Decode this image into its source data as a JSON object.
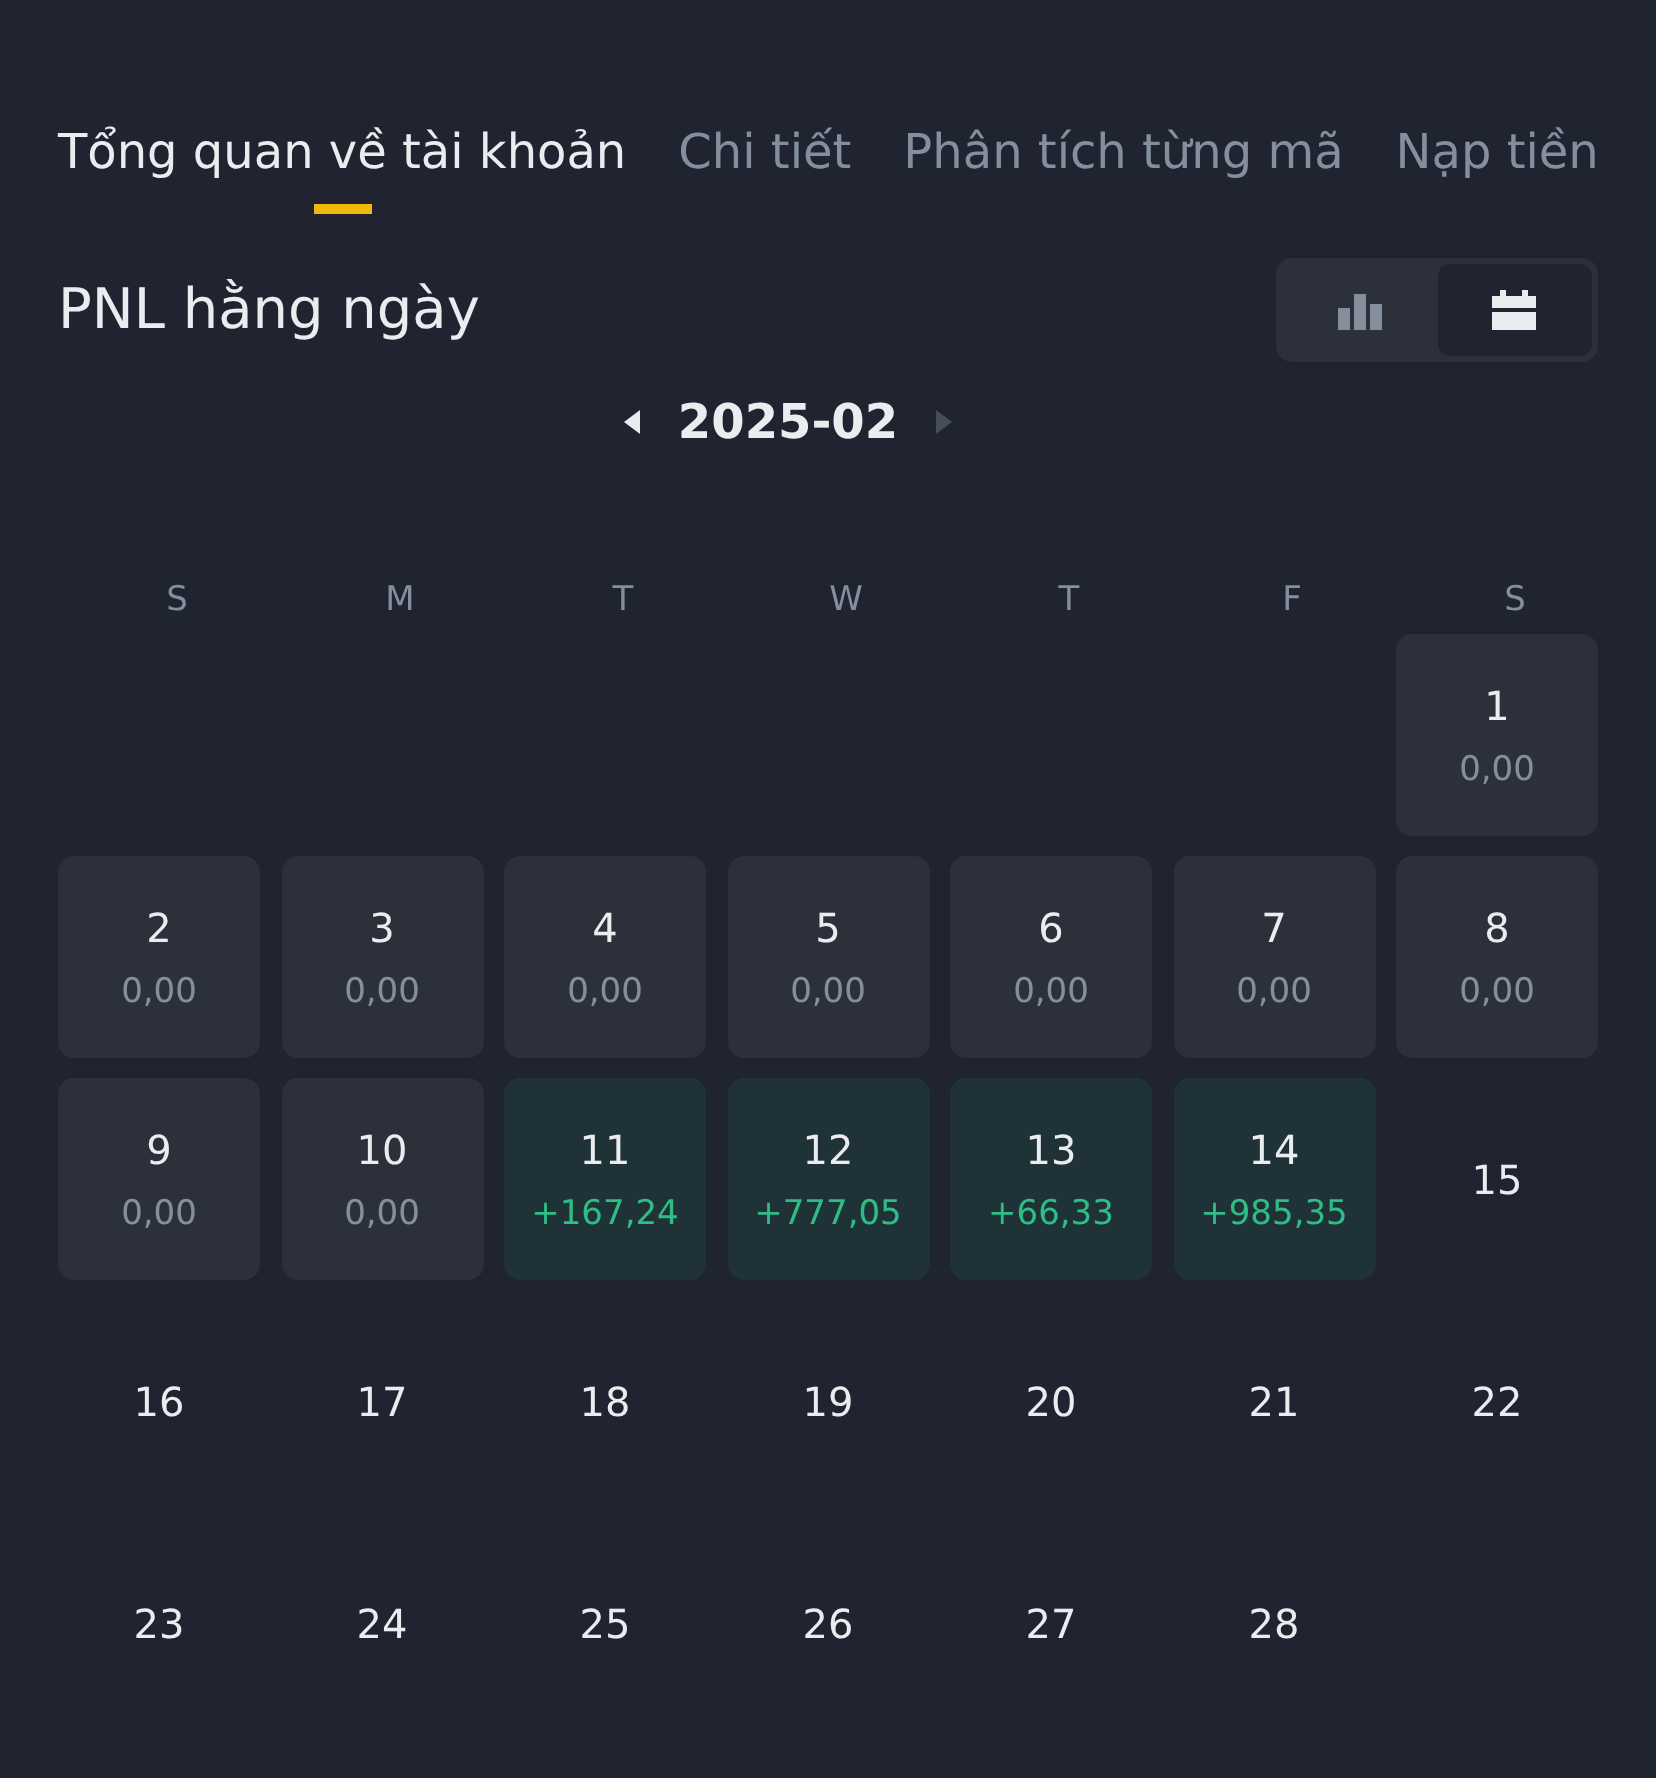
{
  "tabs": [
    {
      "label": "Tổng quan về tài khoản",
      "selected": true
    },
    {
      "label": "Chi tiết",
      "selected": false
    },
    {
      "label": "Phân tích từng mã",
      "selected": false
    },
    {
      "label": "Nạp tiền",
      "selected": false
    }
  ],
  "section_title": "PNL hằng ngày",
  "view_toggle": [
    {
      "kind": "chart",
      "selected": false
    },
    {
      "kind": "calendar",
      "selected": true
    }
  ],
  "month_nav": {
    "label": "2025-02",
    "prev_disabled": false,
    "next_disabled": true
  },
  "weekdays": [
    "S",
    "M",
    "T",
    "W",
    "T",
    "F",
    "S"
  ],
  "days": [
    {
      "kind": "blank"
    },
    {
      "kind": "blank"
    },
    {
      "kind": "blank"
    },
    {
      "kind": "blank"
    },
    {
      "kind": "blank"
    },
    {
      "kind": "blank"
    },
    {
      "day": "1",
      "kind": "zero",
      "pnl": "0,00"
    },
    {
      "day": "2",
      "kind": "zero",
      "pnl": "0,00"
    },
    {
      "day": "3",
      "kind": "zero",
      "pnl": "0,00"
    },
    {
      "day": "4",
      "kind": "zero",
      "pnl": "0,00"
    },
    {
      "day": "5",
      "kind": "zero",
      "pnl": "0,00"
    },
    {
      "day": "6",
      "kind": "zero",
      "pnl": "0,00"
    },
    {
      "day": "7",
      "kind": "zero",
      "pnl": "0,00"
    },
    {
      "day": "8",
      "kind": "zero",
      "pnl": "0,00"
    },
    {
      "day": "9",
      "kind": "zero",
      "pnl": "0,00"
    },
    {
      "day": "10",
      "kind": "zero",
      "pnl": "0,00"
    },
    {
      "day": "11",
      "kind": "profit",
      "pnl": "+167,24"
    },
    {
      "day": "12",
      "kind": "profit",
      "pnl": "+777,05"
    },
    {
      "day": "13",
      "kind": "profit",
      "pnl": "+66,33"
    },
    {
      "day": "14",
      "kind": "profit",
      "pnl": "+985,35"
    },
    {
      "day": "15",
      "kind": "future"
    },
    {
      "day": "16",
      "kind": "future"
    },
    {
      "day": "17",
      "kind": "future"
    },
    {
      "day": "18",
      "kind": "future"
    },
    {
      "day": "19",
      "kind": "future"
    },
    {
      "day": "20",
      "kind": "future"
    },
    {
      "day": "21",
      "kind": "future"
    },
    {
      "day": "22",
      "kind": "future"
    },
    {
      "day": "23",
      "kind": "future"
    },
    {
      "day": "24",
      "kind": "future"
    },
    {
      "day": "25",
      "kind": "future"
    },
    {
      "day": "26",
      "kind": "future"
    },
    {
      "day": "27",
      "kind": "future"
    },
    {
      "day": "28",
      "kind": "future"
    }
  ]
}
